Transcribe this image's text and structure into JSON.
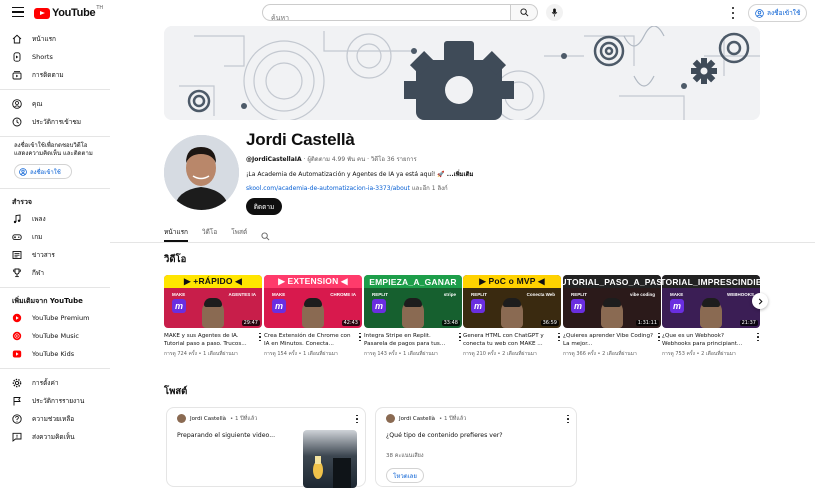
{
  "header": {
    "logo_text": "YouTube",
    "logo_suffix": "TH",
    "search_placeholder": "ค้นหา",
    "signin_label": "ลงชื่อเข้าใช้"
  },
  "sidebar": {
    "primary": [
      {
        "label": "หน้าแรก",
        "icon": "home-icon"
      },
      {
        "label": "Shorts",
        "icon": "shorts-icon"
      },
      {
        "label": "การติดตาม",
        "icon": "subscriptions-icon"
      }
    ],
    "secondary": [
      {
        "label": "คุณ",
        "icon": "user-icon"
      },
      {
        "label": "ประวัติการเข้าชม",
        "icon": "history-icon"
      }
    ],
    "signin_message": "ลงชื่อเข้าใช้เพื่อกดชอบวิดีโอ แสดงความคิดเห็น และติดตาม",
    "signin_label": "ลงชื่อเข้าใช้",
    "explore_title": "สำรวจ",
    "explore": [
      {
        "label": "เพลง",
        "icon": "music-icon"
      },
      {
        "label": "เกม",
        "icon": "gaming-icon"
      },
      {
        "label": "ข่าวสาร",
        "icon": "news-icon"
      },
      {
        "label": "กีฬา",
        "icon": "trophy-icon"
      }
    ],
    "more_title": "เพิ่มเติมจาก YouTube",
    "more": [
      {
        "label": "YouTube Premium"
      },
      {
        "label": "YouTube Music"
      },
      {
        "label": "YouTube Kids"
      }
    ],
    "settings": [
      {
        "label": "การตั้งค่า",
        "icon": "gear-icon"
      },
      {
        "label": "ประวัติการรายงาน",
        "icon": "flag-icon"
      },
      {
        "label": "ความช่วยเหลือ",
        "icon": "help-icon"
      },
      {
        "label": "ส่งความคิดเห็น",
        "icon": "feedback-icon"
      }
    ]
  },
  "channel": {
    "name": "Jordi Castellà",
    "handle": "@JordiCastellaIA",
    "meta_rest": " · ผู้ติดตาม 4.99 พัน คน · วิดีโอ 36 รายการ",
    "description": "¡La Academia de Automatización y Agentes de IA ya está aquí! 🚀",
    "description_more": " ...เพิ่มเติม",
    "link": "skool.com/academia-de-automatizacion-ia-3373/about",
    "link_more": " และอีก 1 ลิงก์",
    "subscribe_label": "ติดตาม"
  },
  "tabs": [
    "หน้าแรก",
    "วิดีโอ",
    "โพสต์"
  ],
  "videos_section_title": "วิดีโอ",
  "videos": [
    {
      "band": "▶ +RÁPIDO ◀",
      "band_bg": "#ffe500",
      "band_fg": "#111111",
      "bg": "#c81e4a",
      "tag_left": "MAKE",
      "tag_right": "AGENTES IA",
      "duration": "29:47",
      "title": "MAKE y sus Agentes de IA. Tutorial paso a paso. Trucos...",
      "meta": "การดู 724 ครั้ง • 1 เดือนที่ผ่านมา"
    },
    {
      "band": "▶ EXTENSION ◀",
      "band_bg": "#ff3b6b",
      "band_fg": "#ffffff",
      "bg": "#d8194d",
      "tag_left": "MAKE",
      "tag_right": "CHROME IA",
      "duration": "42:43",
      "title": "Crea Extensión de Chrome con IA en Minutos. Conecta...",
      "meta": "การดู 154 ครั้ง • 1 เดือนที่ผ่านมา"
    },
    {
      "band": "EMPIEZA_A_GANAR",
      "band_bg": "#1d9e4a",
      "band_fg": "#ffffff",
      "bg": "#16602f",
      "tag_left": "REPLIT",
      "tag_right": "stripe",
      "duration": "33:48",
      "title": "Integra Stripe en Replit. Pasarela de pagos para tus...",
      "meta": "การดู 143 ครั้ง • 1 เดือนที่ผ่านมา"
    },
    {
      "band": "▶ PoC o MVP ◀",
      "band_bg": "#ffd200",
      "band_fg": "#111111",
      "bg": "#3a2a10",
      "tag_left": "REPLIT",
      "tag_right": "Conecta Web",
      "duration": "36:59",
      "title": "Genera HTML con ChatGPT y conecta tu web con MAKE ...",
      "meta": "การดู 210 ครั้ง • 2 เดือนที่ผ่านมา"
    },
    {
      "band": "TUTORIAL_PASO_A_PASO",
      "band_bg": "#222222",
      "band_fg": "#ffffff",
      "bg": "#2b1a1a",
      "tag_left": "REPLIT",
      "tag_right": "vibe coding",
      "duration": "1:31:11",
      "title": "¿Quieres aprender Vibe Coding? La mejor...",
      "meta": "การดู 366 ครั้ง • 2 เดือนที่ผ่านมา"
    },
    {
      "band": "TUTORIAL_IMPRESCINDIBLE",
      "band_bg": "#222222",
      "band_fg": "#ffffff",
      "bg": "#3b1e55",
      "tag_left": "MAKE",
      "tag_right": "WEBHOOKS",
      "duration": "21:37",
      "title": "¿Que es un Webhook? Webhooks para principiant...",
      "meta": "การดู 753 ครั้ง • 2 เดือนที่ผ่านมา"
    }
  ],
  "posts_section_title": "โพสต์",
  "posts": [
    {
      "author": "Jordi Castellà",
      "time": " • 1 ปีที่แล้ว",
      "text": "Preparando el siguiente video..."
    },
    {
      "author": "Jordi Castellà",
      "time": " • 1 ปีที่แล้ว",
      "text": "¿Qué tipo de contenido prefieres ver?",
      "votes": "38 คะแนนเสียง",
      "vote_label": "โหวตเลย"
    }
  ],
  "colors": {
    "brand_red": "#ff0000",
    "link_blue": "#065fd4",
    "purple": "#6a2ee0"
  }
}
